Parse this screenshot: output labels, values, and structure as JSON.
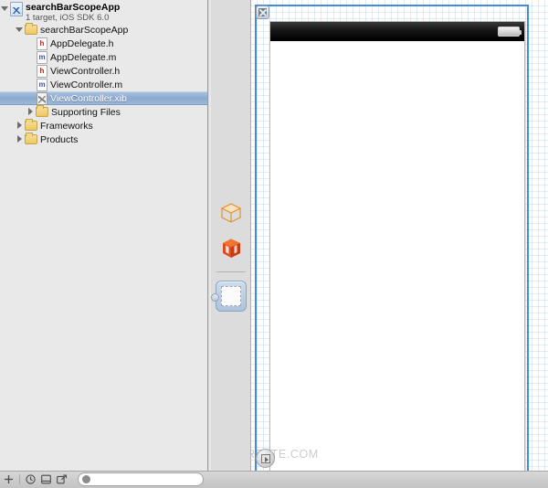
{
  "navigator": {
    "project": {
      "name": "searchBarScopeApp",
      "subtitle": "1 target, iOS SDK 6.0",
      "icon": "xcode-project-icon",
      "disclosure": "open"
    },
    "items": [
      {
        "label": "searchBarScopeApp",
        "icon": "folder-icon",
        "indent": 1,
        "disclosure": "open",
        "selected": false
      },
      {
        "label": "AppDelegate.h",
        "icon": "header-file-icon",
        "badge": "h",
        "indent": 3,
        "disclosure": "none",
        "selected": false
      },
      {
        "label": "AppDelegate.m",
        "icon": "source-file-icon",
        "badge": "m",
        "indent": 3,
        "disclosure": "none",
        "selected": false
      },
      {
        "label": "ViewController.h",
        "icon": "header-file-icon",
        "badge": "h",
        "indent": 3,
        "disclosure": "none",
        "selected": false
      },
      {
        "label": "ViewController.m",
        "icon": "source-file-icon",
        "badge": "m",
        "indent": 3,
        "disclosure": "none",
        "selected": false
      },
      {
        "label": "ViewController.xib",
        "icon": "xib-file-icon",
        "indent": 3,
        "disclosure": "none",
        "selected": true
      },
      {
        "label": "Supporting Files",
        "icon": "folder-icon",
        "indent": 2,
        "disclosure": "closed",
        "selected": false
      },
      {
        "label": "Frameworks",
        "icon": "folder-icon",
        "indent": 1,
        "disclosure": "closed",
        "selected": false
      },
      {
        "label": "Products",
        "icon": "folder-icon",
        "indent": 1,
        "disclosure": "closed",
        "selected": false
      }
    ]
  },
  "dock": {
    "items": [
      {
        "name": "placeholder-cube-outline",
        "label": "File's Owner",
        "icon": "cube-outline-icon"
      },
      {
        "name": "placeholder-cube-solid",
        "label": "First Responder",
        "icon": "cube-solid-icon"
      },
      {
        "name": "dock-object-view",
        "label": "View",
        "icon": "view-object-icon"
      }
    ]
  },
  "canvas": {
    "close_badge_icon": "close-icon",
    "expand_button_icon": "disclosure-triangle-icon",
    "watermark": "WWW.THECREATE.COM",
    "device": {
      "statusbar": {
        "battery_icon": "battery-full-icon"
      },
      "background_color": "#ffffff"
    },
    "selection_color": "#3f8ddc",
    "grid_color": "#78a5d7"
  },
  "statusbar": {
    "icons": [
      "add-icon",
      "history-icon",
      "editor-icon",
      "share-icon"
    ],
    "filter_placeholder": "",
    "filter_icon": "filter-dot-icon"
  }
}
